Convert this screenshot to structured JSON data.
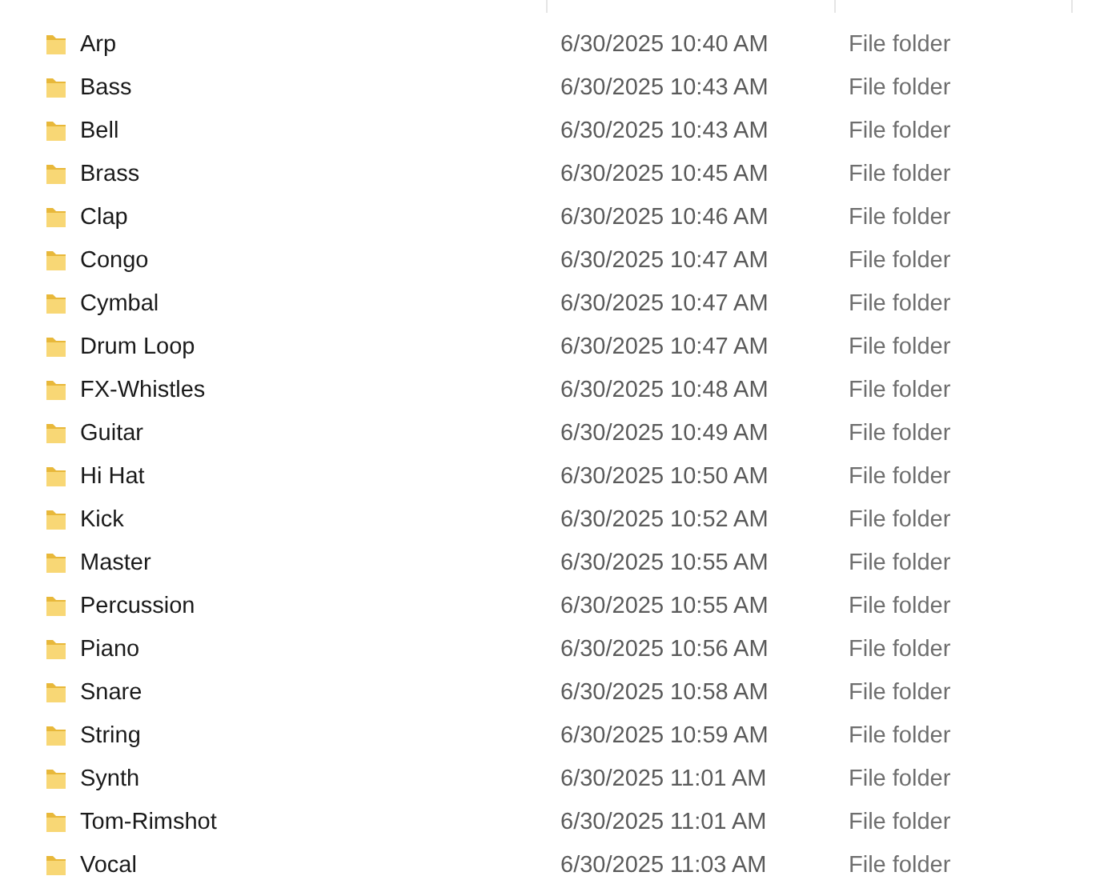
{
  "rows": [
    {
      "name": "Arp",
      "date_modified": "6/30/2025 10:40 AM",
      "type": "File folder"
    },
    {
      "name": "Bass",
      "date_modified": "6/30/2025 10:43 AM",
      "type": "File folder"
    },
    {
      "name": "Bell",
      "date_modified": "6/30/2025 10:43 AM",
      "type": "File folder"
    },
    {
      "name": "Brass",
      "date_modified": "6/30/2025 10:45 AM",
      "type": "File folder"
    },
    {
      "name": "Clap",
      "date_modified": "6/30/2025 10:46 AM",
      "type": "File folder"
    },
    {
      "name": "Congo",
      "date_modified": "6/30/2025 10:47 AM",
      "type": "File folder"
    },
    {
      "name": "Cymbal",
      "date_modified": "6/30/2025 10:47 AM",
      "type": "File folder"
    },
    {
      "name": "Drum Loop",
      "date_modified": "6/30/2025 10:47 AM",
      "type": "File folder"
    },
    {
      "name": "FX-Whistles",
      "date_modified": "6/30/2025 10:48 AM",
      "type": "File folder"
    },
    {
      "name": "Guitar",
      "date_modified": "6/30/2025 10:49 AM",
      "type": "File folder"
    },
    {
      "name": "Hi Hat",
      "date_modified": "6/30/2025 10:50 AM",
      "type": "File folder"
    },
    {
      "name": "Kick",
      "date_modified": "6/30/2025 10:52 AM",
      "type": "File folder"
    },
    {
      "name": "Master",
      "date_modified": "6/30/2025 10:55 AM",
      "type": "File folder"
    },
    {
      "name": "Percussion",
      "date_modified": "6/30/2025 10:55 AM",
      "type": "File folder"
    },
    {
      "name": "Piano",
      "date_modified": "6/30/2025 10:56 AM",
      "type": "File folder"
    },
    {
      "name": "Snare",
      "date_modified": "6/30/2025 10:58 AM",
      "type": "File folder"
    },
    {
      "name": "String",
      "date_modified": "6/30/2025 10:59 AM",
      "type": "File folder"
    },
    {
      "name": "Synth",
      "date_modified": "6/30/2025 11:01 AM",
      "type": "File folder"
    },
    {
      "name": "Tom-Rimshot",
      "date_modified": "6/30/2025 11:01 AM",
      "type": "File folder"
    },
    {
      "name": "Vocal",
      "date_modified": "6/30/2025 11:03 AM",
      "type": "File folder"
    }
  ]
}
